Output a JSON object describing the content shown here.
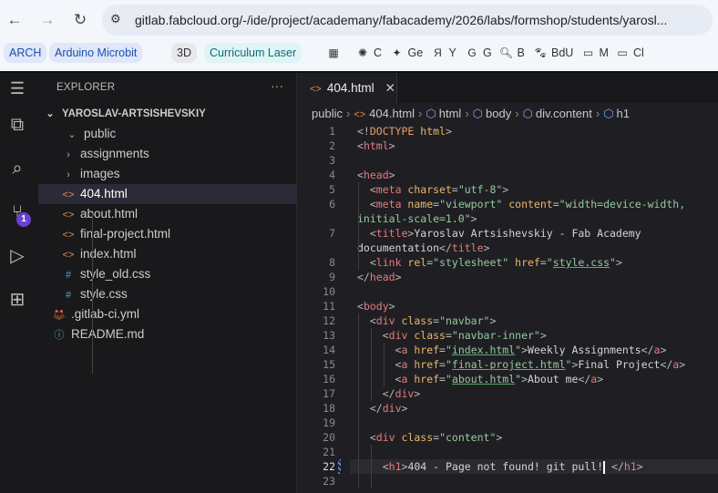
{
  "browser": {
    "url": "gitlab.fabcloud.org/-/ide/project/academany/fabacademy/2026/labs/formshop/students/yarosl...",
    "bookmarks": [
      {
        "label": "ARCH",
        "bg": "#dfe7f8",
        "color": "#1a4fb0",
        "chip": true
      },
      {
        "label": "Arduino Microbit",
        "bg": "#dfe7f8",
        "color": "#1a4fb0",
        "chip": true
      },
      {
        "label": "3D",
        "bg": "#e6e8ec",
        "color": "#333",
        "chip": true
      },
      {
        "label": "Curriculum Laser",
        "bg": "#e0f3f5",
        "color": "#0b6e76",
        "chip": true
      },
      {
        "label": "",
        "icon": "▦",
        "chip": false
      },
      {
        "label": "C",
        "icon": "✺",
        "chip": false
      },
      {
        "label": "Ge",
        "icon": "✦",
        "chip": false
      },
      {
        "label": "Y",
        "icon": "Я",
        "chip": false
      },
      {
        "label": "G",
        "icon": "G",
        "chip": false
      },
      {
        "label": "B",
        "icon": "🔍︎",
        "chip": false
      },
      {
        "label": "BdU",
        "icon": "🐾︎",
        "chip": false
      },
      {
        "label": "M",
        "icon": "▭",
        "chip": false
      },
      {
        "label": "Cl",
        "icon": "▭",
        "chip": false
      }
    ]
  },
  "explorer": {
    "title": "EXPLORER",
    "more": "···",
    "root": "YAROSLAV-ARTSISHEVSKIY",
    "items": [
      {
        "label": "public",
        "type": "folder-open",
        "depth": 1
      },
      {
        "label": "assignments",
        "type": "folder",
        "depth": 2
      },
      {
        "label": "images",
        "type": "folder",
        "depth": 2
      },
      {
        "label": "404.html",
        "type": "html",
        "depth": 2,
        "selected": true
      },
      {
        "label": "about.html",
        "type": "html",
        "depth": 2
      },
      {
        "label": "final-project.html",
        "type": "html",
        "depth": 2
      },
      {
        "label": "index.html",
        "type": "html",
        "depth": 2
      },
      {
        "label": "style_old.css",
        "type": "css",
        "depth": 2
      },
      {
        "label": "style.css",
        "type": "css",
        "depth": 2
      },
      {
        "label": ".gitlab-ci.yml",
        "type": "gitlab",
        "depth": 1
      },
      {
        "label": "README.md",
        "type": "info",
        "depth": 1
      }
    ],
    "scm_badge": "1"
  },
  "editor": {
    "tab": "404.html",
    "breadcrumbs": [
      "public",
      "404.html",
      "html",
      "body",
      "div.content",
      "h1"
    ],
    "current_line": 22,
    "lines": [
      [
        [
          "p",
          "<!"
        ],
        [
          "doc",
          "DOCTYPE"
        ],
        [
          "attr",
          " html"
        ],
        [
          "p",
          ">"
        ]
      ],
      [
        [
          "p",
          "<"
        ],
        [
          "tag",
          "html"
        ],
        [
          "p",
          ">"
        ]
      ],
      [],
      [
        [
          "p",
          "<"
        ],
        [
          "tag",
          "head"
        ],
        [
          "p",
          ">"
        ]
      ],
      [
        [
          "txt",
          "  "
        ],
        [
          "p",
          "<"
        ],
        [
          "tag",
          "meta"
        ],
        [
          "attr",
          " charset"
        ],
        [
          "p",
          "="
        ],
        [
          "str",
          "\"utf-8\""
        ],
        [
          "p",
          ">"
        ]
      ],
      [
        [
          "txt",
          "  "
        ],
        [
          "p",
          "<"
        ],
        [
          "tag",
          "meta"
        ],
        [
          "attr",
          " name"
        ],
        [
          "p",
          "="
        ],
        [
          "str",
          "\"viewport\""
        ],
        [
          "attr",
          " content"
        ],
        [
          "p",
          "="
        ],
        [
          "str",
          "\"width=device-width, initial-scale=1.0\""
        ],
        [
          "p",
          ">"
        ]
      ],
      [
        [
          "txt",
          "  "
        ],
        [
          "p",
          "<"
        ],
        [
          "tag",
          "title"
        ],
        [
          "p",
          ">"
        ],
        [
          "txt",
          "Yaroslav Artsishevskiy - Fab Academy documentation"
        ],
        [
          "p",
          "</"
        ],
        [
          "tag",
          "title"
        ],
        [
          "p",
          ">"
        ]
      ],
      [
        [
          "txt",
          "  "
        ],
        [
          "p",
          "<"
        ],
        [
          "tag",
          "link"
        ],
        [
          "attr",
          " rel"
        ],
        [
          "p",
          "="
        ],
        [
          "str",
          "\"stylesheet\""
        ],
        [
          "attr",
          " href"
        ],
        [
          "p",
          "="
        ],
        [
          "str",
          "\""
        ],
        [
          "link",
          "style.css"
        ],
        [
          "str",
          "\""
        ],
        [
          "p",
          ">"
        ]
      ],
      [
        [
          "p",
          "</"
        ],
        [
          "tag",
          "head"
        ],
        [
          "p",
          ">"
        ]
      ],
      [],
      [
        [
          "p",
          "<"
        ],
        [
          "tag",
          "body"
        ],
        [
          "p",
          ">"
        ]
      ],
      [
        [
          "txt",
          "  "
        ],
        [
          "p",
          "<"
        ],
        [
          "tag",
          "div"
        ],
        [
          "attr",
          " class"
        ],
        [
          "p",
          "="
        ],
        [
          "str",
          "\"navbar\""
        ],
        [
          "p",
          ">"
        ]
      ],
      [
        [
          "txt",
          "    "
        ],
        [
          "p",
          "<"
        ],
        [
          "tag",
          "div"
        ],
        [
          "attr",
          " class"
        ],
        [
          "p",
          "="
        ],
        [
          "str",
          "\"navbar-inner\""
        ],
        [
          "p",
          ">"
        ]
      ],
      [
        [
          "txt",
          "      "
        ],
        [
          "p",
          "<"
        ],
        [
          "tag",
          "a"
        ],
        [
          "attr",
          " href"
        ],
        [
          "p",
          "="
        ],
        [
          "str",
          "\""
        ],
        [
          "link",
          "index.html"
        ],
        [
          "str",
          "\""
        ],
        [
          "p",
          ">"
        ],
        [
          "txt",
          "Weekly Assignments"
        ],
        [
          "p",
          "</"
        ],
        [
          "tag",
          "a"
        ],
        [
          "p",
          ">"
        ]
      ],
      [
        [
          "txt",
          "      "
        ],
        [
          "p",
          "<"
        ],
        [
          "tag",
          "a"
        ],
        [
          "attr",
          " href"
        ],
        [
          "p",
          "="
        ],
        [
          "str",
          "\""
        ],
        [
          "link",
          "final-project.html"
        ],
        [
          "str",
          "\""
        ],
        [
          "p",
          ">"
        ],
        [
          "txt",
          "Final Project"
        ],
        [
          "p",
          "</"
        ],
        [
          "tag",
          "a"
        ],
        [
          "p",
          ">"
        ]
      ],
      [
        [
          "txt",
          "      "
        ],
        [
          "p",
          "<"
        ],
        [
          "tag",
          "a"
        ],
        [
          "attr",
          " href"
        ],
        [
          "p",
          "="
        ],
        [
          "str",
          "\""
        ],
        [
          "link",
          "about.html"
        ],
        [
          "str",
          "\""
        ],
        [
          "p",
          ">"
        ],
        [
          "txt",
          "About me"
        ],
        [
          "p",
          "</"
        ],
        [
          "tag",
          "a"
        ],
        [
          "p",
          ">"
        ]
      ],
      [
        [
          "txt",
          "    "
        ],
        [
          "p",
          "</"
        ],
        [
          "tag",
          "div"
        ],
        [
          "p",
          ">"
        ]
      ],
      [
        [
          "txt",
          "  "
        ],
        [
          "p",
          "</"
        ],
        [
          "tag",
          "div"
        ],
        [
          "p",
          ">"
        ]
      ],
      [],
      [
        [
          "txt",
          "  "
        ],
        [
          "p",
          "<"
        ],
        [
          "tag",
          "div"
        ],
        [
          "attr",
          " class"
        ],
        [
          "p",
          "="
        ],
        [
          "str",
          "\"content\""
        ],
        [
          "p",
          ">"
        ]
      ],
      [],
      [
        [
          "txt",
          "    "
        ],
        [
          "p",
          "<"
        ],
        [
          "tag",
          "h1"
        ],
        [
          "p",
          ">"
        ],
        [
          "txt",
          "404 - Page not found! git pull!"
        ],
        [
          "caret",
          ""
        ],
        [
          "txt",
          " "
        ],
        [
          "p",
          "</"
        ],
        [
          "tag",
          "h1"
        ],
        [
          "p",
          ">"
        ]
      ],
      []
    ]
  }
}
